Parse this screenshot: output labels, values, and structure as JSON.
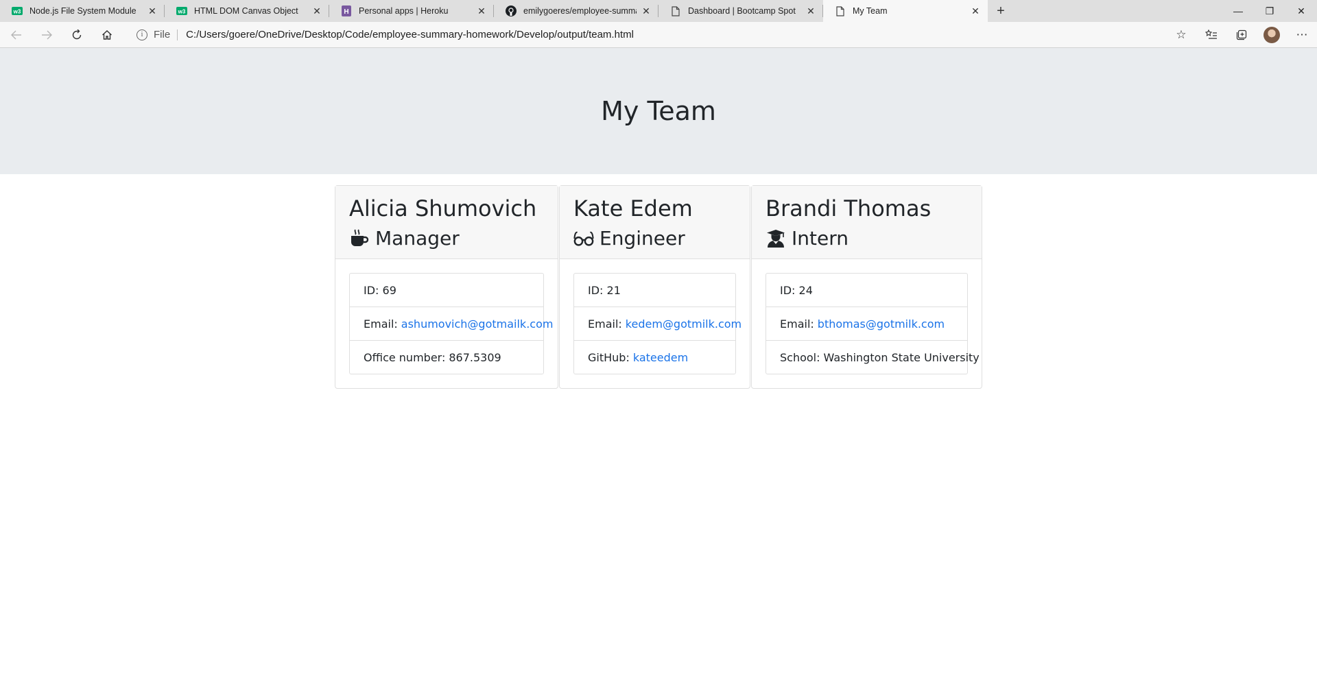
{
  "browser": {
    "tabs": [
      {
        "title": "Node.js File System Module",
        "icon": "w3schools-icon"
      },
      {
        "title": "HTML DOM Canvas Object",
        "icon": "w3schools-icon"
      },
      {
        "title": "Personal apps | Heroku",
        "icon": "heroku-icon"
      },
      {
        "title": "emilygoeres/employee-summary",
        "icon": "github-icon"
      },
      {
        "title": "Dashboard | Bootcamp Spot",
        "icon": "page-icon"
      },
      {
        "title": "My Team",
        "icon": "page-icon",
        "active": true
      }
    ],
    "address": {
      "scheme_label": "File",
      "url": "C:/Users/goere/OneDrive/Desktop/Code/employee-summary-homework/Develop/output/team.html"
    }
  },
  "page": {
    "heading": "My Team",
    "employees": [
      {
        "name": "Alicia Shumovich",
        "role": "Manager",
        "role_icon": "mug-hot-icon",
        "id_label": "ID: 69",
        "email_label": "Email:",
        "email": "ashumovich@gotmailk.com",
        "extra_label": "Office number:",
        "extra_value": "867.5309"
      },
      {
        "name": "Kate Edem",
        "role": "Engineer",
        "role_icon": "glasses-icon",
        "id_label": "ID: 21",
        "email_label": "Email:",
        "email": "kedem@gotmilk.com",
        "extra_label": "GitHub:",
        "extra_value": "kateedem"
      },
      {
        "name": "Brandi Thomas",
        "role": "Intern",
        "role_icon": "user-graduate-icon",
        "id_label": "ID: 24",
        "email_label": "Email:",
        "email": "bthomas@gotmilk.com",
        "extra_label": "School:",
        "extra_value": "Washington State University"
      }
    ]
  },
  "colors": {
    "link": "#1a73e8",
    "jumbotron_bg": "#e9ecef",
    "card_header_bg": "#f7f7f7"
  }
}
